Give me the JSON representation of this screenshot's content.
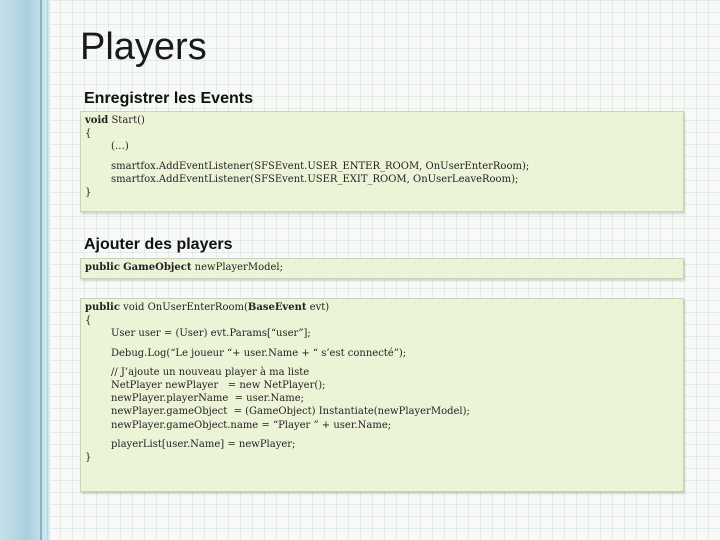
{
  "slide": {
    "title": "Players",
    "section1_heading": "Enregistrer les Events",
    "section2_heading": "Ajouter des players"
  },
  "box1": {
    "l1_kw": "void",
    "l1_rest": " Start()",
    "l2": "{",
    "l3": "(…)",
    "l4": "smartfox.AddEventListener(SFSEvent.USER_ENTER_ROOM, OnUserEnterRoom);",
    "l5": "smartfox.AddEventListener(SFSEvent.USER_EXIT_ROOM, OnUserLeaveRoom);",
    "l6": "}"
  },
  "box2": {
    "kw1": "public",
    "sp1": " ",
    "kw2": "GameObject",
    "rest": " newPlayerModel;"
  },
  "box3": {
    "l1_kw": "public",
    "l1_mid": " void OnUserEnterRoom(",
    "l1_kw2": "BaseEvent",
    "l1_rest": " evt)",
    "l2": "{",
    "l3": "User user = (User) evt.Params[“user”];",
    "l4": "Debug.Log(“Le joueur “+ user.Name + “ s’est connecté”);",
    "l5": "// J’ajoute un nouveau player à ma liste",
    "l6": "NetPlayer newPlayer   = new NetPlayer();",
    "l7": "newPlayer.playerName  = user.Name;",
    "l8": "newPlayer.gameObject  = (GameObject) Instantiate(newPlayerModel);",
    "l9": "newPlayer.gameObject.name = “Player ” + user.Name;",
    "l10": "playerList[user.Name] = newPlayer;",
    "l11": "}"
  }
}
